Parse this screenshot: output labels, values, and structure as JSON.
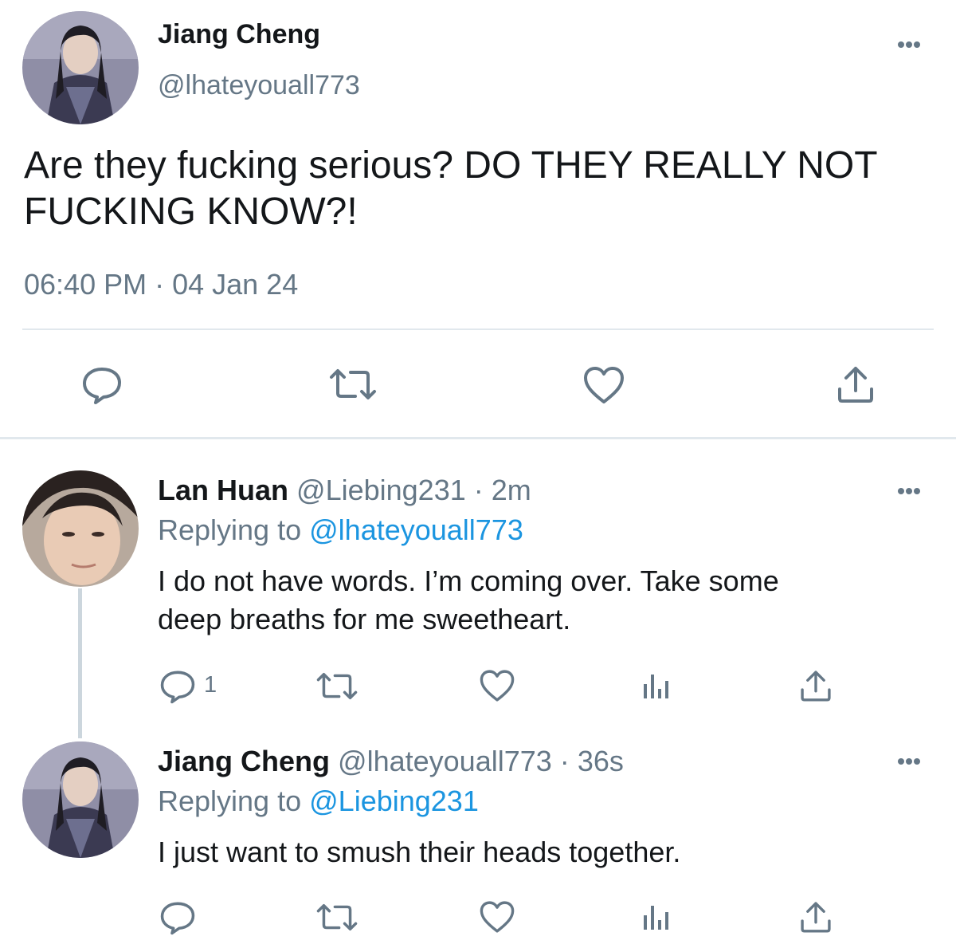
{
  "main_tweet": {
    "display_name": "Jiang Cheng",
    "handle": "@lhateyouall773",
    "text_line1": "Are they fucking serious? DO THEY REALLY NOT",
    "text_line2": "FUCKING KNOW?!",
    "timestamp": "06:40 PM · 04 Jan 24",
    "actions": [
      "reply-icon",
      "retweet-icon",
      "like-icon",
      "share-icon"
    ]
  },
  "replies": [
    {
      "display_name": "Lan Huan",
      "handle": "@Liebing231",
      "separator": "·",
      "time": "2m",
      "replying_prefix": "Replying to",
      "replying_handle": "@lhateyouall773",
      "text_line1": "I do not have words. I’m coming over. Take some",
      "text_line2": "deep breaths for me sweetheart.",
      "reply_count": "1",
      "actions": [
        "reply-icon",
        "retweet-icon",
        "like-icon",
        "analytics-icon",
        "share-icon"
      ]
    },
    {
      "display_name": "Jiang Cheng",
      "handle": "@lhateyouall773",
      "separator": "·",
      "time": "36s",
      "replying_prefix": "Replying to",
      "replying_handle": "@Liebing231",
      "text_line1": "I just want to smush their heads together.",
      "actions": [
        "reply-icon",
        "retweet-icon",
        "like-icon",
        "analytics-icon",
        "share-icon"
      ]
    }
  ],
  "colors": {
    "link": "#1b95e0",
    "secondary": "#657786",
    "text": "#14171a",
    "divider": "#e1e8ed"
  }
}
